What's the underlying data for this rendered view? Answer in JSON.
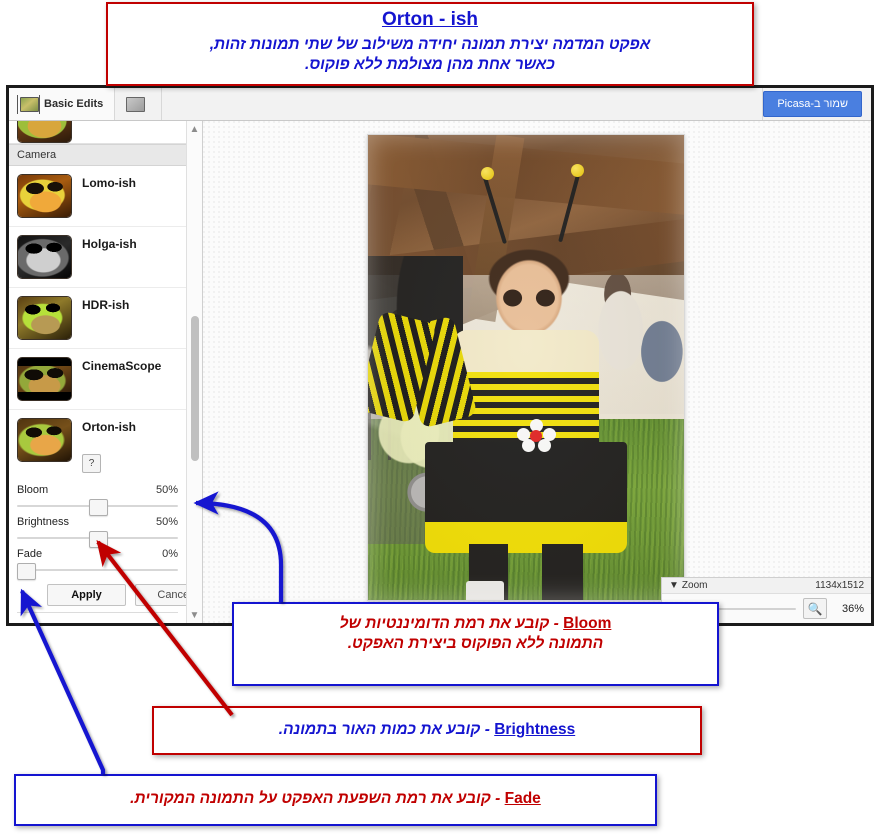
{
  "toolbar": {
    "tabs": [
      {
        "label": "Basic Edits",
        "icon": "basic-edits-icon"
      },
      {
        "label": "",
        "icon": "effects-icon"
      }
    ],
    "save_button": "שמור ב-Picasa"
  },
  "effects_panel": {
    "section_header": "Camera",
    "items": [
      {
        "label": "Lomo-ish",
        "thumb": "frog-lomo-thumb"
      },
      {
        "label": "Holga-ish",
        "thumb": "frog-holga-thumb"
      },
      {
        "label": "HDR-ish",
        "thumb": "frog-hdr-thumb"
      },
      {
        "label": "CinemaScope",
        "thumb": "frog-cinemascope-thumb"
      },
      {
        "label": "Orton-ish",
        "thumb": "frog-orton-thumb"
      }
    ],
    "help_button": "?",
    "sliders": [
      {
        "label": "Bloom",
        "value": "50%",
        "percent": 50
      },
      {
        "label": "Brightness",
        "value": "50%",
        "percent": 50
      },
      {
        "label": "Fade",
        "value": "0%",
        "percent": 0
      }
    ],
    "apply_button": "Apply",
    "cancel_button": "Cancel"
  },
  "zoom_bar": {
    "label": "Zoom",
    "dimensions": "1134x1512",
    "magnifier_icon": "magnifier-icon",
    "percent": "36%"
  },
  "callouts": {
    "title": {
      "heading": "Orton - ish",
      "line1": "אפקט המדמה יצירת תמונה יחידה משילוב של שתי תמונות זהות,",
      "line2": "כאשר אחת מהן מצולמת ללא פוקוס.",
      "border_color": "#c00000",
      "text_color": "#1414d0"
    },
    "bloom": {
      "term": "Bloom",
      "line1": "- קובע את רמת הדומיננטיות של",
      "line2": "התמונה ללא הפוקוס ביצירת האפקט.",
      "border_color": "#1414d0",
      "text_color": "#c00000"
    },
    "brightness": {
      "term": "Brightness",
      "line1": "- קובע את כמות האור בתמונה.",
      "border_color": "#c00000",
      "text_color": "#1414d0"
    },
    "fade": {
      "term": "Fade",
      "line1": "- קובע את רמת השפעת האפקט על התמונה המקורית.",
      "border_color": "#1414d0",
      "text_color": "#c00000"
    }
  },
  "arrows": {
    "bloom_arrow_color": "#1414d0",
    "brightness_arrow_color": "#c00000",
    "fade_arrow_color": "#1414d0"
  }
}
